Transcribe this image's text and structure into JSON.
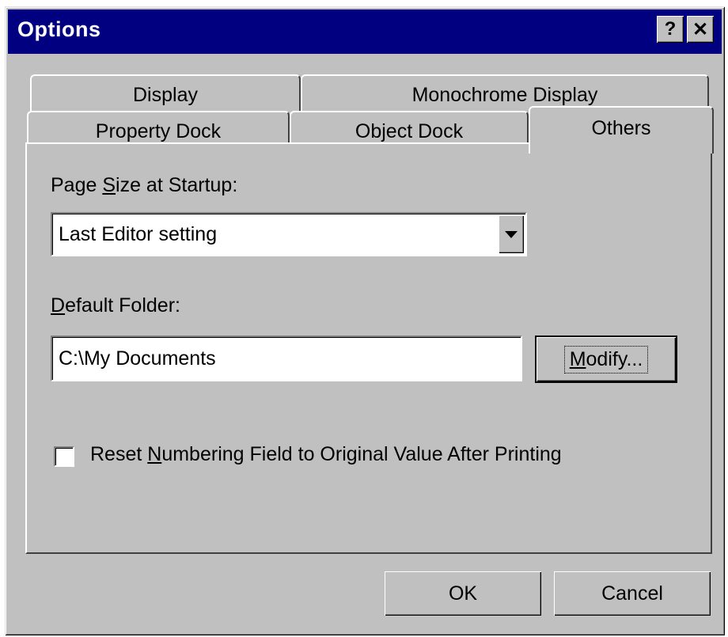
{
  "window": {
    "title": "Options",
    "help_glyph": "?",
    "close_glyph": "✕"
  },
  "tabs": {
    "row1": [
      {
        "label": "Display"
      },
      {
        "label": "Monochrome Display"
      }
    ],
    "row2": [
      {
        "label": "Property Dock"
      },
      {
        "label": "Object Dock"
      },
      {
        "label": "Others",
        "selected": true
      }
    ]
  },
  "others": {
    "page_size_label_pre": "Page ",
    "page_size_label_key": "S",
    "page_size_label_post": "ize at Startup:",
    "page_size_value": "Last Editor setting",
    "default_folder_label_key": "D",
    "default_folder_label_post": "efault Folder:",
    "default_folder_value": "C:\\My Documents",
    "modify_key": "M",
    "modify_post": "odify...",
    "reset_label_pre": "Reset ",
    "reset_label_key": "N",
    "reset_label_post": "umbering Field to Original Value After Printing",
    "reset_checked": false
  },
  "footer": {
    "ok_label": "OK",
    "cancel_label": "Cancel"
  },
  "icons": {
    "help": "help-icon",
    "close": "close-icon",
    "dropdown": "chevron-down-icon"
  }
}
